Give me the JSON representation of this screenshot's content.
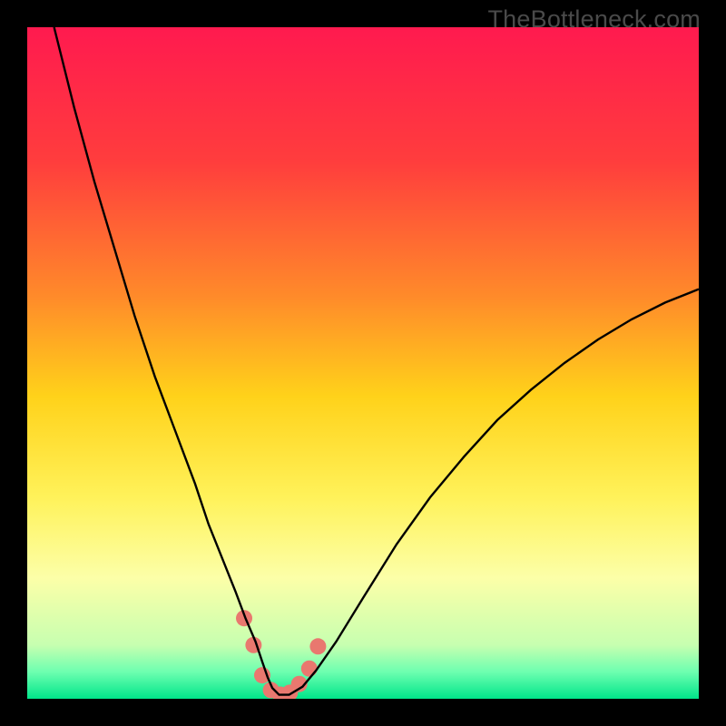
{
  "watermark": "TheBottleneck.com",
  "chart_data": {
    "type": "line",
    "title": "",
    "xlabel": "",
    "ylabel": "",
    "xlim": [
      0,
      100
    ],
    "ylim": [
      0,
      100
    ],
    "legend": false,
    "grid": false,
    "background_gradient": [
      {
        "stop": 0.0,
        "color": "#ff1a4f"
      },
      {
        "stop": 0.2,
        "color": "#ff3d3d"
      },
      {
        "stop": 0.4,
        "color": "#ff8a2a"
      },
      {
        "stop": 0.55,
        "color": "#ffd21a"
      },
      {
        "stop": 0.7,
        "color": "#fff25a"
      },
      {
        "stop": 0.82,
        "color": "#fcffa8"
      },
      {
        "stop": 0.92,
        "color": "#c7ffb0"
      },
      {
        "stop": 0.96,
        "color": "#6dffb0"
      },
      {
        "stop": 1.0,
        "color": "#00e58a"
      }
    ],
    "series": [
      {
        "name": "curve",
        "color": "#000000",
        "stroke_width": 2,
        "x": [
          4,
          7,
          10,
          13,
          16,
          19,
          22,
          25,
          27,
          29,
          31,
          32.5,
          34,
          35,
          35.8,
          36.5,
          37.5,
          39,
          41,
          43,
          46,
          50,
          55,
          60,
          65,
          70,
          75,
          80,
          85,
          90,
          95,
          100
        ],
        "y": [
          100,
          88,
          77,
          67,
          57,
          48,
          40,
          32,
          26,
          21,
          16,
          12,
          8.5,
          5.5,
          3.2,
          1.6,
          0.6,
          0.6,
          1.8,
          4.2,
          8.5,
          15,
          23,
          30,
          36,
          41.5,
          46,
          50,
          53.5,
          56.5,
          59,
          61
        ]
      },
      {
        "name": "markers",
        "type": "scatter",
        "color": "#e9786f",
        "radius": 9,
        "x": [
          32.3,
          33.7,
          35.0,
          36.3,
          37.7,
          39.1,
          40.5,
          42.0,
          43.3
        ],
        "y": [
          12.0,
          8.0,
          3.5,
          1.3,
          0.6,
          0.9,
          2.2,
          4.5,
          7.8
        ]
      }
    ],
    "annotations": []
  }
}
